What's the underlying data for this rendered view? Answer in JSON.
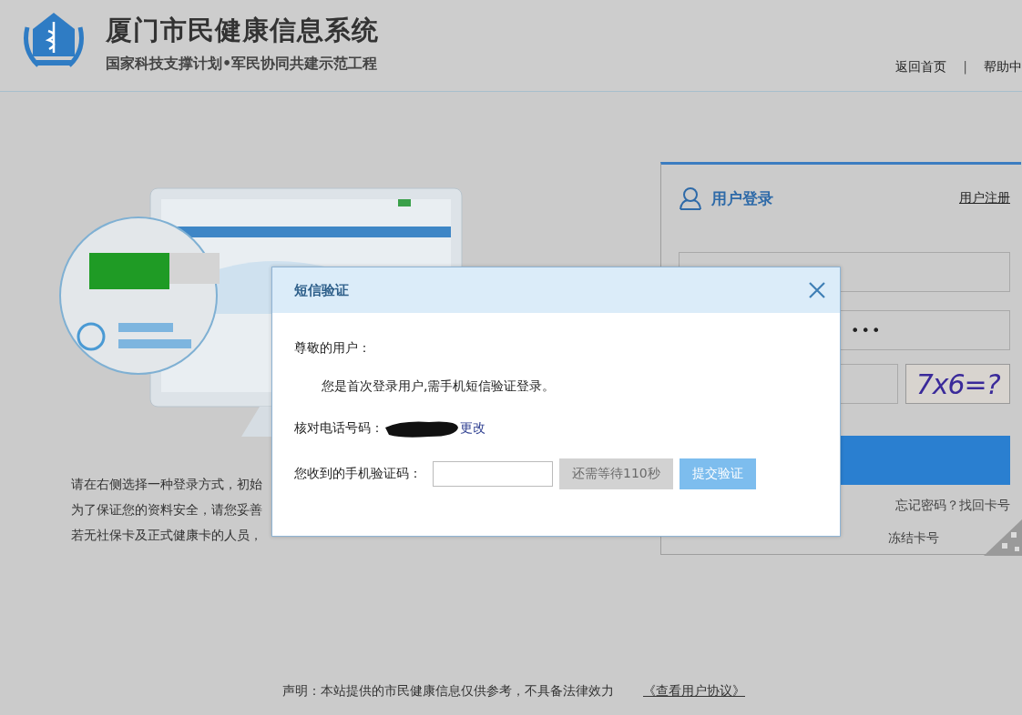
{
  "header": {
    "title": "厦门市民健康信息系统",
    "subtitle": "国家科技支撑计划•军民协同共建示范工程",
    "nav": [
      {
        "label": "返回首页"
      },
      {
        "label": "|",
        "kind": "separator"
      },
      {
        "label": "帮助中"
      }
    ]
  },
  "intro": {
    "lines": [
      "请在右侧选择一种登录方式，初始",
      "为了保证您的资料安全，请您妥善",
      "若无社保卡及正式健康卡的人员，"
    ]
  },
  "login_panel": {
    "title": "用户登录",
    "register_link": "用户注册",
    "password_value": "•••",
    "captcha": "7x6=?",
    "links": [
      "忘记密码？找回卡号",
      "冻结卡号"
    ]
  },
  "dialog": {
    "title": "短信验证",
    "greeting": "尊敬的用户：",
    "message": "您是首次登录用户,需手机短信验证登录。",
    "phone_label": "核对电话号码：",
    "change_link": "更改",
    "code_label": "您收到的手机验证码：",
    "buttons": [
      {
        "label": "还需等待110秒",
        "kind": "wait",
        "disabled": true
      },
      {
        "label": "提交验证",
        "kind": "submit",
        "disabled": true
      }
    ]
  },
  "footer": {
    "notice": "声明：本站提供的市民健康信息仅供参考，不具备法律效力",
    "agreement_link": "《查看用户协议》"
  }
}
